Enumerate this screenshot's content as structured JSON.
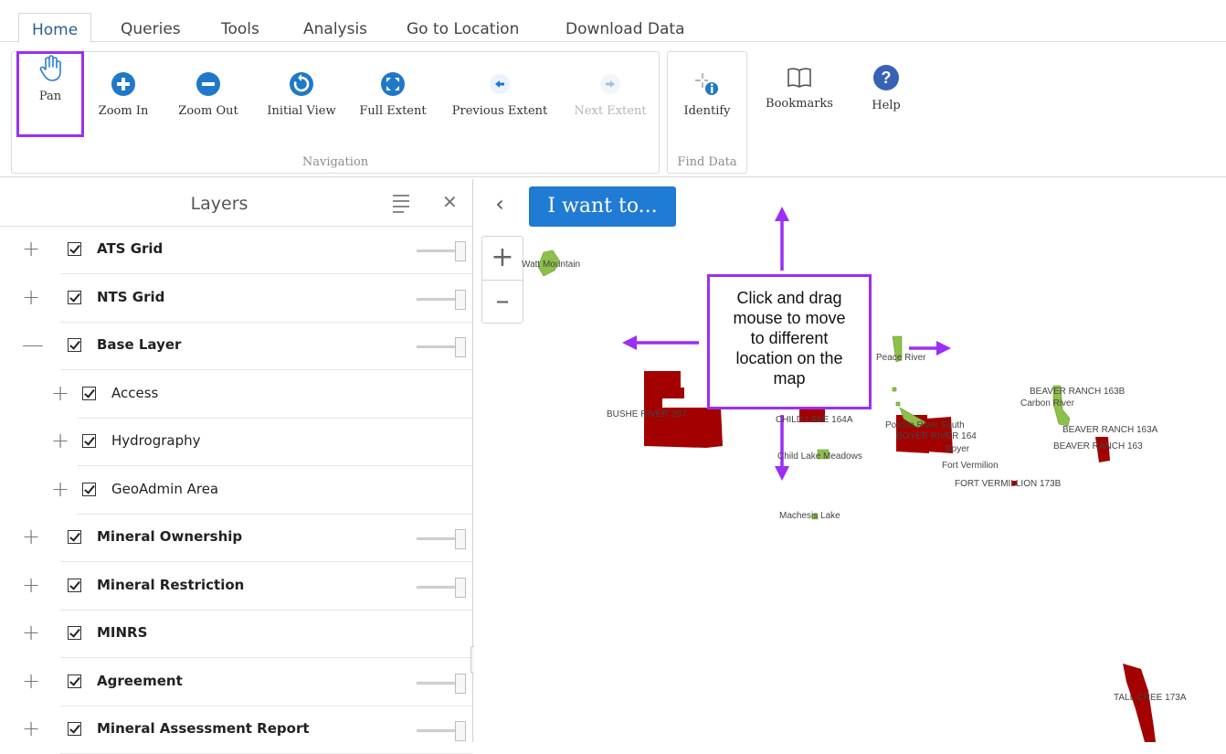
{
  "tabs": [
    {
      "label": "Home",
      "active": true
    },
    {
      "label": "Queries"
    },
    {
      "label": "Tools"
    },
    {
      "label": "Analysis"
    },
    {
      "label": "Go to Location"
    },
    {
      "label": "Download Data"
    }
  ],
  "ribbon": {
    "navigation": {
      "label": "Navigation",
      "buttons": [
        {
          "label": "Pan",
          "icon": "hand-icon"
        },
        {
          "label": "Zoom In",
          "icon": "plus-circle-icon"
        },
        {
          "label": "Zoom Out",
          "icon": "minus-circle-icon"
        },
        {
          "label": "Initial View",
          "icon": "refresh-icon"
        },
        {
          "label": "Full Extent",
          "icon": "expand-icon"
        },
        {
          "label": "Previous Extent",
          "icon": "arrow-left-circle-icon"
        },
        {
          "label": "Next Extent",
          "icon": "arrow-right-circle-icon",
          "disabled": true
        }
      ]
    },
    "find_data": {
      "label": "Find Data",
      "buttons": [
        {
          "label": "Identify",
          "icon": "identify-icon"
        }
      ]
    },
    "extras": [
      {
        "label": "Bookmarks",
        "icon": "book-icon"
      },
      {
        "label": "Help",
        "icon": "question-icon"
      }
    ]
  },
  "panel": {
    "title": "Layers",
    "layers": [
      {
        "name": "ATS Grid",
        "expander": "+",
        "bold": true,
        "checked": true,
        "slider": true
      },
      {
        "name": "NTS Grid",
        "expander": "+",
        "bold": true,
        "checked": true,
        "slider": true
      },
      {
        "name": "Base Layer",
        "expander": "—",
        "bold": true,
        "checked": true,
        "slider": true
      },
      {
        "name": "Access",
        "expander": "+",
        "bold": false,
        "checked": true,
        "slider": false,
        "child": true
      },
      {
        "name": "Hydrography",
        "expander": "+",
        "bold": false,
        "checked": true,
        "slider": false,
        "child": true
      },
      {
        "name": "GeoAdmin Area",
        "expander": "+",
        "bold": false,
        "checked": true,
        "slider": false,
        "child": true
      },
      {
        "name": "Mineral Ownership",
        "expander": "+",
        "bold": true,
        "checked": true,
        "slider": true
      },
      {
        "name": "Mineral Restriction",
        "expander": "+",
        "bold": true,
        "checked": true,
        "slider": true
      },
      {
        "name": "MINRS",
        "expander": "+",
        "bold": true,
        "checked": true,
        "slider": false
      },
      {
        "name": "Agreement",
        "expander": "+",
        "bold": true,
        "checked": true,
        "slider": true
      },
      {
        "name": "Mineral Assessment Report",
        "expander": "+",
        "bold": true,
        "checked": true,
        "slider": true
      }
    ]
  },
  "map": {
    "i_want_to": "I want to...",
    "callout_lines": [
      "Click and drag",
      "mouse to move",
      "to different",
      "location on the",
      "map"
    ],
    "labels": [
      "Watt Mountain",
      "BUSHE RIVER 207",
      "CHILD LAKE 164A",
      "Child Lake Meadows",
      "Peace River",
      "Ponton River South",
      "BOYER RIVER 164",
      "Boyer",
      "Fort Vermilion",
      "FORT VERMILLION 173B",
      "Machesis Lake",
      "BEAVER RANCH 163B",
      "Carbon River",
      "BEAVER RANCH 163A",
      "BEAVER RANCH 163",
      "TALL CREE 173A"
    ],
    "colors": {
      "reserve": "#a30000",
      "park": "#8dc04b",
      "arrow": "#9b2ff3"
    }
  }
}
